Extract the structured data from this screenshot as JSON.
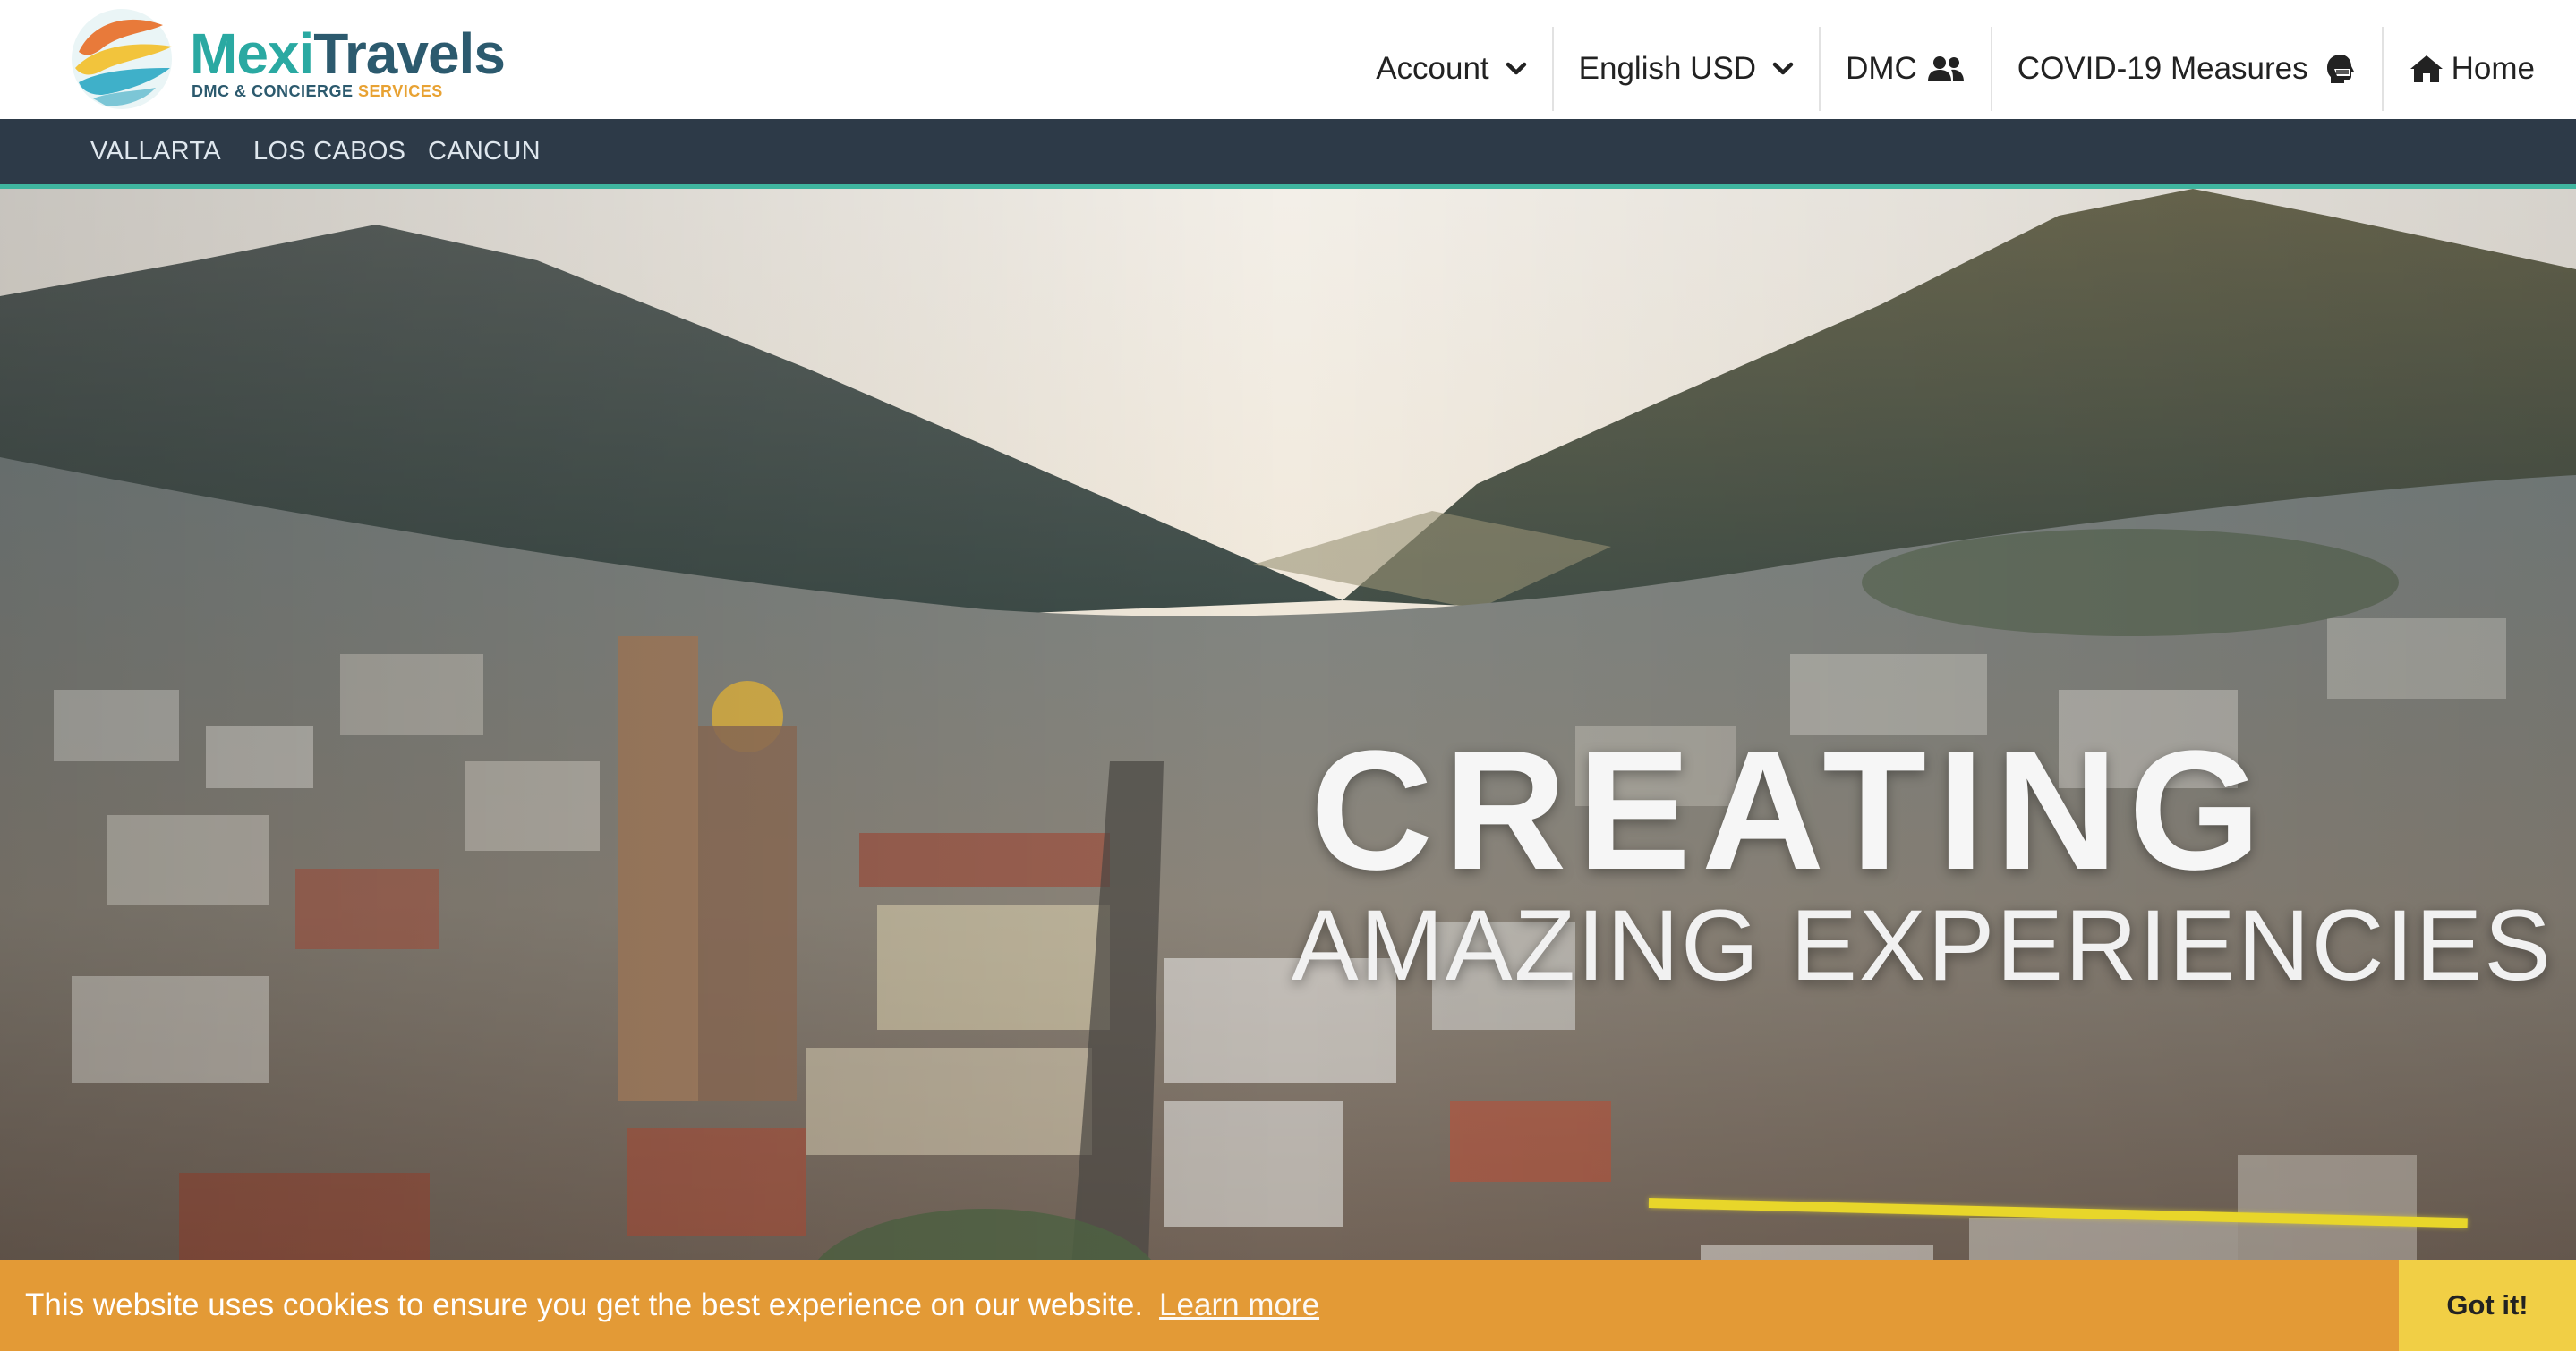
{
  "brand": {
    "name_part1": "Mexi",
    "name_part2": "Travels",
    "tagline_part1": "DMC & CONCIERGE",
    "tagline_part2": "SERVICES"
  },
  "topnav": {
    "account": "Account",
    "language": "English USD",
    "dmc": "DMC",
    "covid": "COVID-19 Measures",
    "home": "Home"
  },
  "subnav": {
    "items": [
      "VALLARTA",
      "LOS CABOS",
      "CANCUN"
    ]
  },
  "hero": {
    "title": "CREATING",
    "subtitle": "AMAZING EXPERIENCIES"
  },
  "cookie": {
    "message": "This website uses cookies to ensure you get the best experience on our website.",
    "learn_more": "Learn more",
    "button": "Got it!"
  },
  "colors": {
    "accent_teal": "#2aa9a2",
    "brand_dark": "#2c5a6e",
    "subnav_bg": "#2d3a48",
    "cookie_bg": "#e39a36",
    "cookie_button": "#f1cf45",
    "hero_line": "#e8d62a"
  },
  "icons": {
    "account": "chevron-down-icon",
    "language": "chevron-down-icon",
    "dmc": "users-icon",
    "covid": "head-mask-icon",
    "home": "home-icon"
  }
}
